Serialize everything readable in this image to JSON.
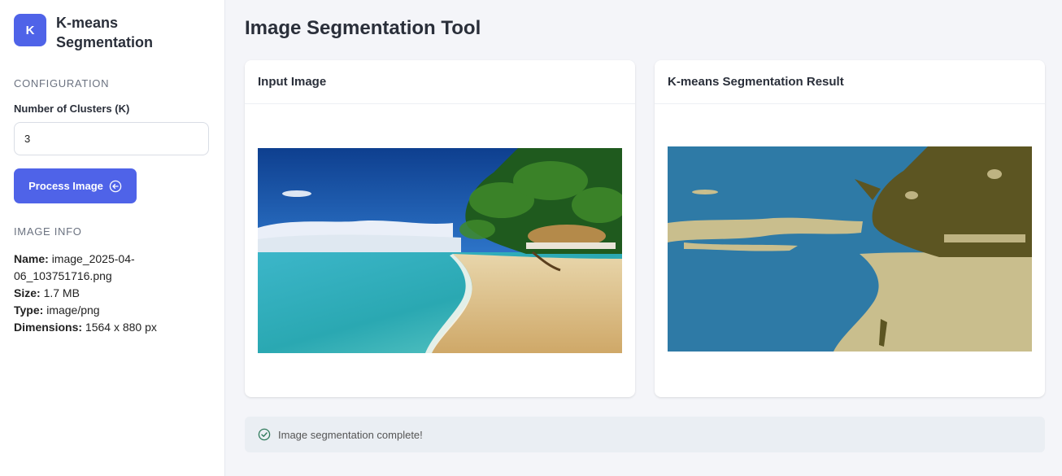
{
  "sidebar": {
    "logo_letter": "K",
    "brand_title": "K-means Segmentation",
    "config_heading": "CONFIGURATION",
    "clusters_label": "Number of Clusters (K)",
    "clusters_value": "3",
    "process_button": "Process Image",
    "image_info_heading": "IMAGE INFO",
    "info": {
      "name_label": "Name:",
      "name_value": "image_2025-04-06_103751716.png",
      "size_label": "Size:",
      "size_value": "1.7 MB",
      "type_label": "Type:",
      "type_value": "image/png",
      "dimensions_label": "Dimensions:",
      "dimensions_value": "1564 x 880 px"
    }
  },
  "main": {
    "page_title": "Image Segmentation Tool",
    "input_card_title": "Input Image",
    "result_card_title": "K-means Segmentation Result",
    "status_message": "Image segmentation complete!"
  },
  "colors": {
    "accent": "#4f63e8",
    "segment_water": "#2e7aa6",
    "segment_sand": "#c9be8d",
    "segment_trees": "#5c5522",
    "success": "#2f7a5b"
  }
}
